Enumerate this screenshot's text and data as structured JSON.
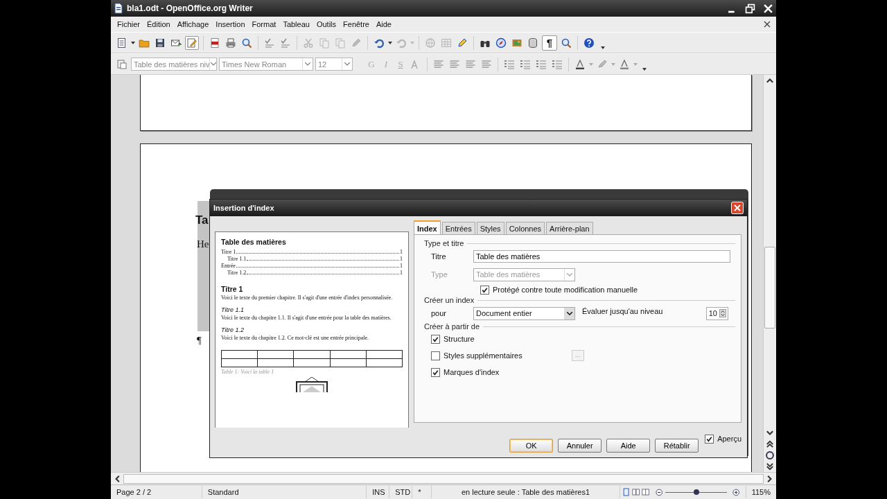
{
  "window": {
    "title": "bla1.odt - OpenOffice.org Writer"
  },
  "menu": [
    "Fichier",
    "Édition",
    "Affichage",
    "Insertion",
    "Format",
    "Tableau",
    "Outils",
    "Fenêtre",
    "Aide"
  ],
  "toolbar": {
    "edit_mode_on": true,
    "formatting_marks": {
      "glyph": "¶",
      "on": true
    }
  },
  "formatting": {
    "style": "Table des matières niv",
    "font": "Times New Roman",
    "size": "12",
    "text_buttons": [
      "G",
      "I",
      "S"
    ]
  },
  "document": {
    "heading": "Ta",
    "text": "He",
    "pilcrow": "¶"
  },
  "dialog": {
    "title": "Insertion d'index",
    "preview": {
      "title": "Table des matières",
      "toc": [
        {
          "text": "Titre 1",
          "page": "1",
          "indent": false
        },
        {
          "text": "Titre 1.1",
          "page": "1",
          "indent": true
        },
        {
          "text": "Entrée",
          "page": "1",
          "indent": false
        },
        {
          "text": "Titre 1.2",
          "page": "1",
          "indent": true
        }
      ],
      "sections": [
        {
          "heading": "Titre 1",
          "italic": false,
          "body": "Voici le texte du premier chapitre. Il s'agit d'une entrée d'index personnalisée."
        },
        {
          "heading": "Titre 1.1",
          "italic": true,
          "body": "Voici le texte du chapitre 1.1. Il s'agit d'une entrée pour la table des matières."
        },
        {
          "heading": "Titre 1.2",
          "italic": true,
          "body": "Voici le texte du chapitre 1.2. Ce mot-clé est une entrée principale."
        }
      ],
      "caption": "Table 1: Voici la table 1"
    },
    "tabs": [
      {
        "label": "Index",
        "selected": true
      },
      {
        "label": "Entrées",
        "selected": false
      },
      {
        "label": "Styles",
        "selected": false
      },
      {
        "label": "Colonnes",
        "selected": false
      },
      {
        "label": "Arrière-plan",
        "selected": false
      }
    ],
    "type_and_title": {
      "legend": "Type et titre",
      "title_label": "Titre",
      "title_value": "Table des matières",
      "type_label": "Type",
      "type_value": "Table des matières",
      "type_disabled": true,
      "protected": {
        "label": "Protégé contre toute modification manuelle",
        "checked": true
      }
    },
    "create_index": {
      "legend": "Créer un index",
      "for_label": "pour",
      "for_value": "Document entier",
      "level_label": "Évaluer jusqu'au niveau",
      "level_value": "10"
    },
    "create_from": {
      "legend": "Créer à partir de",
      "options": [
        {
          "label": "Structure",
          "checked": true,
          "has_button": false
        },
        {
          "label": "Styles supplémentaires",
          "checked": false,
          "has_button": true
        },
        {
          "label": "Marques d'index",
          "checked": true,
          "has_button": false
        }
      ],
      "more_button": "..."
    },
    "buttons": [
      {
        "label": "OK",
        "default": true
      },
      {
        "label": "Annuler",
        "default": false
      },
      {
        "label": "Aide",
        "default": false
      },
      {
        "label": "Rétablir",
        "default": false
      }
    ],
    "preview_toggle": {
      "label": "Aperçu",
      "checked": true
    }
  },
  "status_bar": {
    "page": "Page 2 / 2",
    "style": "Standard",
    "insert_mode": "INS",
    "selection_mode": "STD",
    "modified": "*",
    "info": "en lecture seule : Table des matières1",
    "zoom": {
      "level": 0.5,
      "percent": "115%"
    }
  }
}
